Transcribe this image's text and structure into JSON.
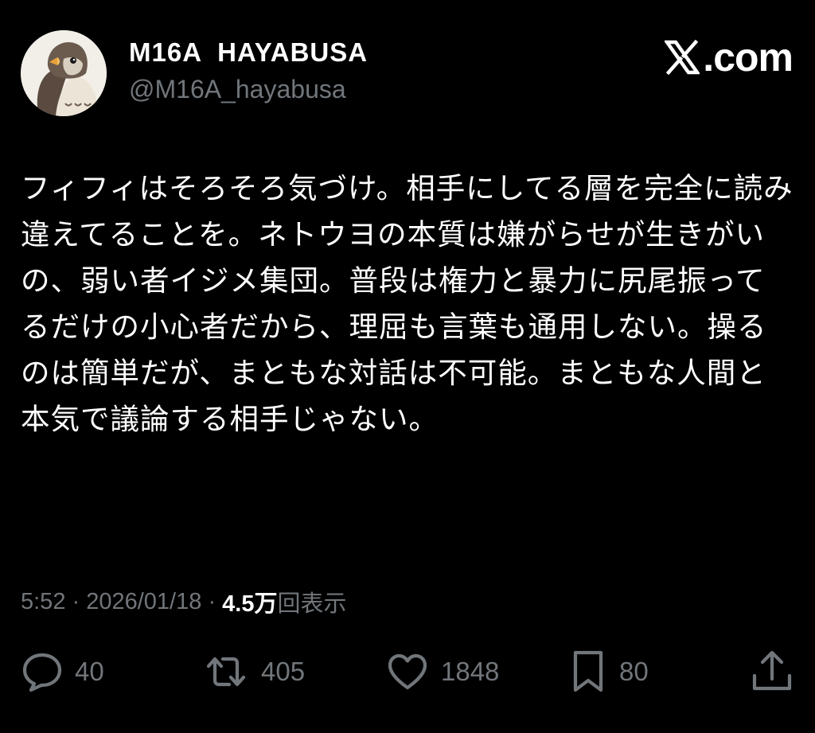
{
  "user": {
    "display_name": "M16A  HAYABUSA",
    "handle": "@M16A_hayabusa",
    "avatar_icon": "falcon-avatar-icon"
  },
  "brand": {
    "icon": "x-logo-icon",
    "text": ".com"
  },
  "tweet": {
    "text": "フィフィはそろそろ気づけ。相手にしてる層を完全に読み違えてることを。ネトウヨの本質は嫌がらせが生きがいの、弱い者イジメ集団。普段は権力と暴力に尻尾振ってるだけの小心者だから、理屈も言葉も通用しない。操るのは簡単だが、まともな対話は不可能。まともな人間と本気で議論する相手じゃない。"
  },
  "meta": {
    "time": "5:52",
    "separator1": " · ",
    "date": "2026/01/18",
    "separator2": " · ",
    "views_count": "4.5万",
    "views_label": "回表示"
  },
  "actions": {
    "reply": {
      "icon": "reply-icon",
      "count": "40"
    },
    "repost": {
      "icon": "repost-icon",
      "count": "405"
    },
    "like": {
      "icon": "heart-icon",
      "count": "1848"
    },
    "bookmark": {
      "icon": "bookmark-icon",
      "count": "80"
    },
    "share": {
      "icon": "share-icon"
    }
  },
  "colors": {
    "background": "#000000",
    "primary_text": "#ffffff",
    "secondary_text": "#71767b"
  }
}
